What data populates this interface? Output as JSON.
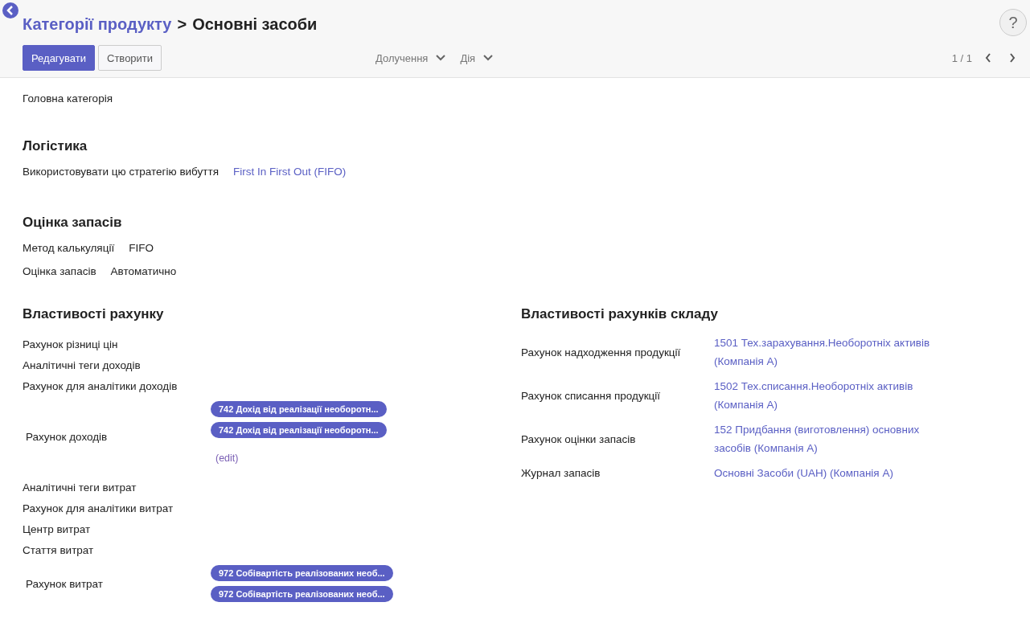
{
  "breadcrumb": {
    "parent": "Категорії продукту",
    "separator": ">",
    "current": "Основні засоби"
  },
  "help": "?",
  "buttons": [
    {
      "label": "Редагувати",
      "kind": "primary"
    },
    {
      "label": "Створити",
      "kind": "secondary"
    }
  ],
  "dropdowns": [
    "Долучення",
    "Дія"
  ],
  "pager": "1 / 1",
  "parent_field": {
    "label": "Головна категорія"
  },
  "logistics": {
    "title": "Логістика",
    "fields": [
      {
        "label": "Використовувати цю стратегію вибуття",
        "value": "First In First Out (FIFO)",
        "kind": "link"
      }
    ]
  },
  "valuation": {
    "title": "Оцінка запасів",
    "fields": [
      {
        "label": "Метод калькуляції",
        "value": "FIFO",
        "kind": "text"
      },
      {
        "label": "Оцінка запасів",
        "value": "Автоматично",
        "kind": "text"
      }
    ]
  },
  "account_properties": {
    "title": "Властивості рахунку",
    "fields": [
      {
        "label": "Рахунок різниці цін",
        "kind": "empty"
      },
      {
        "label": "Аналітичні теги доходів",
        "kind": "empty"
      },
      {
        "label": "Рахунок для аналітики доходів",
        "kind": "empty"
      },
      {
        "label": "Рахунок доходів",
        "kind": "tags",
        "tags": [
          "742 Дохід від реалізації необоротн...",
          "742 Дохід від реалізації необоротн..."
        ],
        "edit": "(edit)"
      },
      {
        "label": "Аналітичні теги витрат",
        "kind": "empty"
      },
      {
        "label": "Рахунок для аналітики витрат",
        "kind": "empty"
      },
      {
        "label": "Центр витрат",
        "kind": "empty"
      },
      {
        "label": "Стаття витрат",
        "kind": "empty"
      },
      {
        "label": "Рахунок витрат",
        "kind": "tags",
        "tags": [
          "972 Собівартість реалізованих необ...",
          "972 Собівартість реалізованих необ..."
        ]
      }
    ]
  },
  "stock_accounts": {
    "title": "Властивості рахунків складу",
    "fields": [
      {
        "label": "Рахунок надходження продукції",
        "value": "1501 Тех.зарахування.Необоротніх активів (Компанія А)",
        "kind": "link"
      },
      {
        "label": "Рахунок списання продукції",
        "value": "1502 Тех.списання.Необоротніх активів (Компанія А)",
        "kind": "link"
      },
      {
        "label": "Рахунок оцінки запасів",
        "value": "152 Придбання (виготовлення) основних засобів (Компанія А)",
        "kind": "link"
      },
      {
        "label": "Журнал запасів",
        "value": "Основні Засоби (UAH) (Компанія А)",
        "kind": "link"
      }
    ]
  }
}
